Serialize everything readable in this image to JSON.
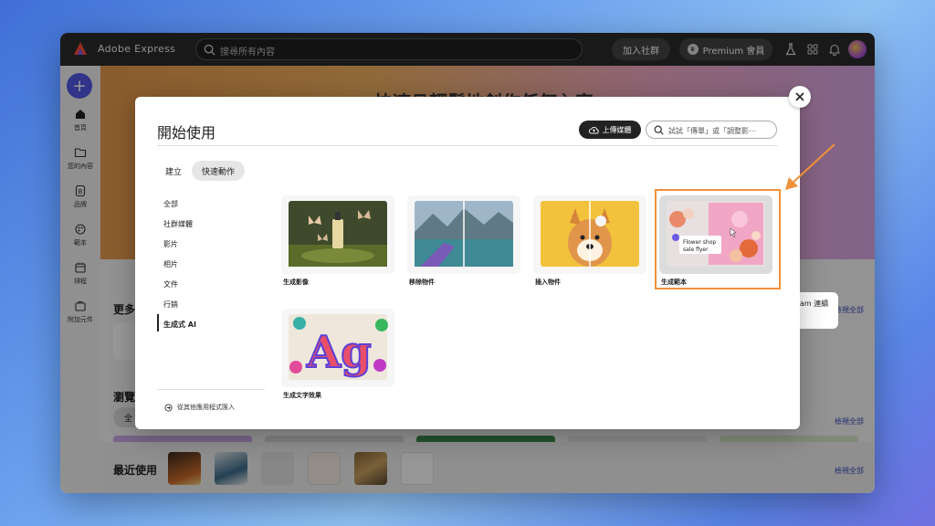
{
  "app": {
    "title": "Adobe Express",
    "search_placeholder": "搜尋所有內容",
    "join_label": "加入社群",
    "premium_label": "Premium 會員"
  },
  "sidebar": {
    "items": [
      {
        "label": "首頁",
        "icon": "home-icon"
      },
      {
        "label": "您的內容",
        "icon": "folder-icon"
      },
      {
        "label": "品牌",
        "icon": "brand-icon"
      },
      {
        "label": "範本",
        "icon": "templates-icon"
      },
      {
        "label": "排程",
        "icon": "calendar-icon"
      },
      {
        "label": "附加元件",
        "icon": "addons-icon"
      }
    ]
  },
  "background": {
    "hero_title": "快速且輕鬆地創作任何內容",
    "more_label": "更多",
    "browse_label": "瀏覽",
    "browse_chip": "全",
    "recent_label": "最近使用",
    "see_all_1": "檢視全部",
    "see_all_2": "檢視全部",
    "see_all_3": "檢視全部",
    "instagram_label": "Instagram 連續短片"
  },
  "modal": {
    "title": "開始使用",
    "upload_label": "上傳媒體",
    "search_placeholder": "試試「傳單」或「調整影⋯",
    "tabs": [
      "建立",
      "快速動作"
    ],
    "active_tab": "快速動作",
    "categories": [
      "全部",
      "社群媒體",
      "影片",
      "相片",
      "文件",
      "行銷",
      "生成式 AI"
    ],
    "active_category": "生成式 AI",
    "import_label": "從其他應用程式匯入",
    "cards": [
      {
        "label": "生成影像"
      },
      {
        "label": "移除物件"
      },
      {
        "label": "插入物件"
      },
      {
        "label": "生成範本",
        "highlighted": true,
        "inner_text": "Flower shop sale flyer"
      },
      {
        "label": "生成文字效果"
      }
    ]
  },
  "colors": {
    "accent": "#5258e4",
    "highlight": "#f0903a",
    "dark": "#222222"
  }
}
